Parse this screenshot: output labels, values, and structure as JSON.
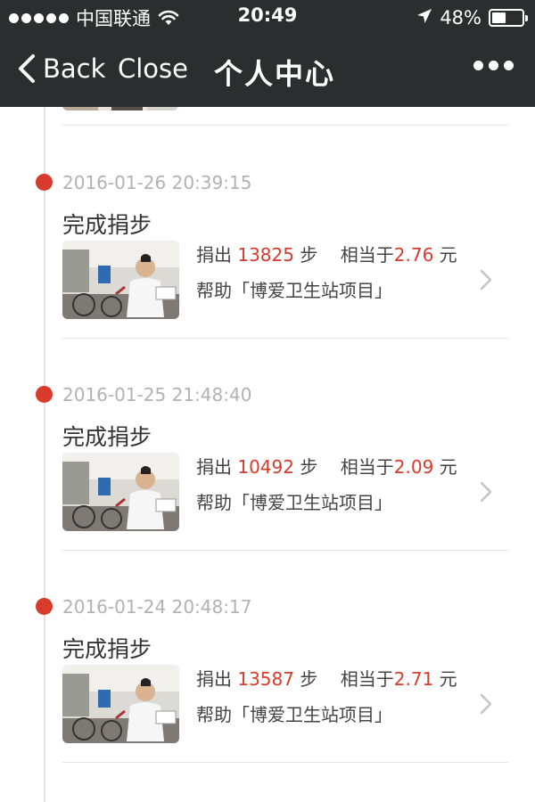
{
  "status_bar": {
    "carrier": "中国联通",
    "time": "20:49",
    "battery_percent": "48%",
    "battery_level": 0.48
  },
  "nav": {
    "back_label": "Back",
    "close_label": "Close",
    "title": "个人中心"
  },
  "entries": [
    {
      "date": "2016-01-26 20:39:15",
      "title": "完成捐步",
      "donate_prefix": "捐出 ",
      "steps": "13825",
      "steps_unit": " 步",
      "equiv_prefix": "相当于",
      "amount": "2.76",
      "amount_unit": " 元",
      "help_text": "帮助「博爱卫生站项目」"
    },
    {
      "date": "2016-01-25 21:48:40",
      "title": "完成捐步",
      "donate_prefix": "捐出 ",
      "steps": "10492",
      "steps_unit": " 步",
      "equiv_prefix": "相当于",
      "amount": "2.09",
      "amount_unit": " 元",
      "help_text": "帮助「博爱卫生站项目」"
    },
    {
      "date": "2016-01-24 20:48:17",
      "title": "完成捐步",
      "donate_prefix": "捐出 ",
      "steps": "13587",
      "steps_unit": " 步",
      "equiv_prefix": "相当于",
      "amount": "2.71",
      "amount_unit": " 元",
      "help_text": "帮助「博爱卫生站项目」"
    }
  ],
  "colors": {
    "bar_background": "#2b2d2f",
    "accent_red": "#d83a2c",
    "date_gray": "#b2b2b2"
  },
  "icons": [
    "signal-dots-icon",
    "wifi-icon",
    "location-arrow-icon",
    "battery-icon",
    "chevron-left-icon",
    "more-dots-icon",
    "chevron-right-icon"
  ]
}
